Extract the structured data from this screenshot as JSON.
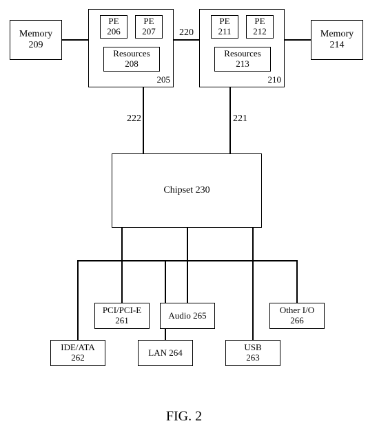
{
  "blocks": {
    "mem_left": {
      "name": "Memory",
      "ref": "209"
    },
    "mem_right": {
      "name": "Memory",
      "ref": "214"
    },
    "cpuA": {
      "ref": "205",
      "pe1": {
        "name": "PE",
        "ref": "206"
      },
      "pe2": {
        "name": "PE",
        "ref": "207"
      },
      "res": {
        "name": "Resources",
        "ref": "208"
      }
    },
    "cpuB": {
      "ref": "210",
      "pe1": {
        "name": "PE",
        "ref": "211"
      },
      "pe2": {
        "name": "PE",
        "ref": "212"
      },
      "res": {
        "name": "Resources",
        "ref": "213"
      }
    },
    "chipset": {
      "name": "Chipset",
      "ref": "230",
      "label": "Chipset 230"
    },
    "io": {
      "pci": {
        "name": "PCI/PCI-E",
        "ref": "261"
      },
      "audio": {
        "name": "Audio",
        "ref": "265",
        "label": "Audio 265"
      },
      "other": {
        "name": "Other I/O",
        "ref": "266"
      },
      "ide": {
        "name": "IDE/ATA",
        "ref": "262"
      },
      "lan": {
        "name": "LAN",
        "ref": "264",
        "label": "LAN 264"
      },
      "usb": {
        "name": "USB",
        "ref": "263"
      }
    }
  },
  "links": {
    "inter_cpu": "220",
    "cpuA_chip": "222",
    "cpuB_chip": "221"
  },
  "figure_caption": "FIG. 2"
}
